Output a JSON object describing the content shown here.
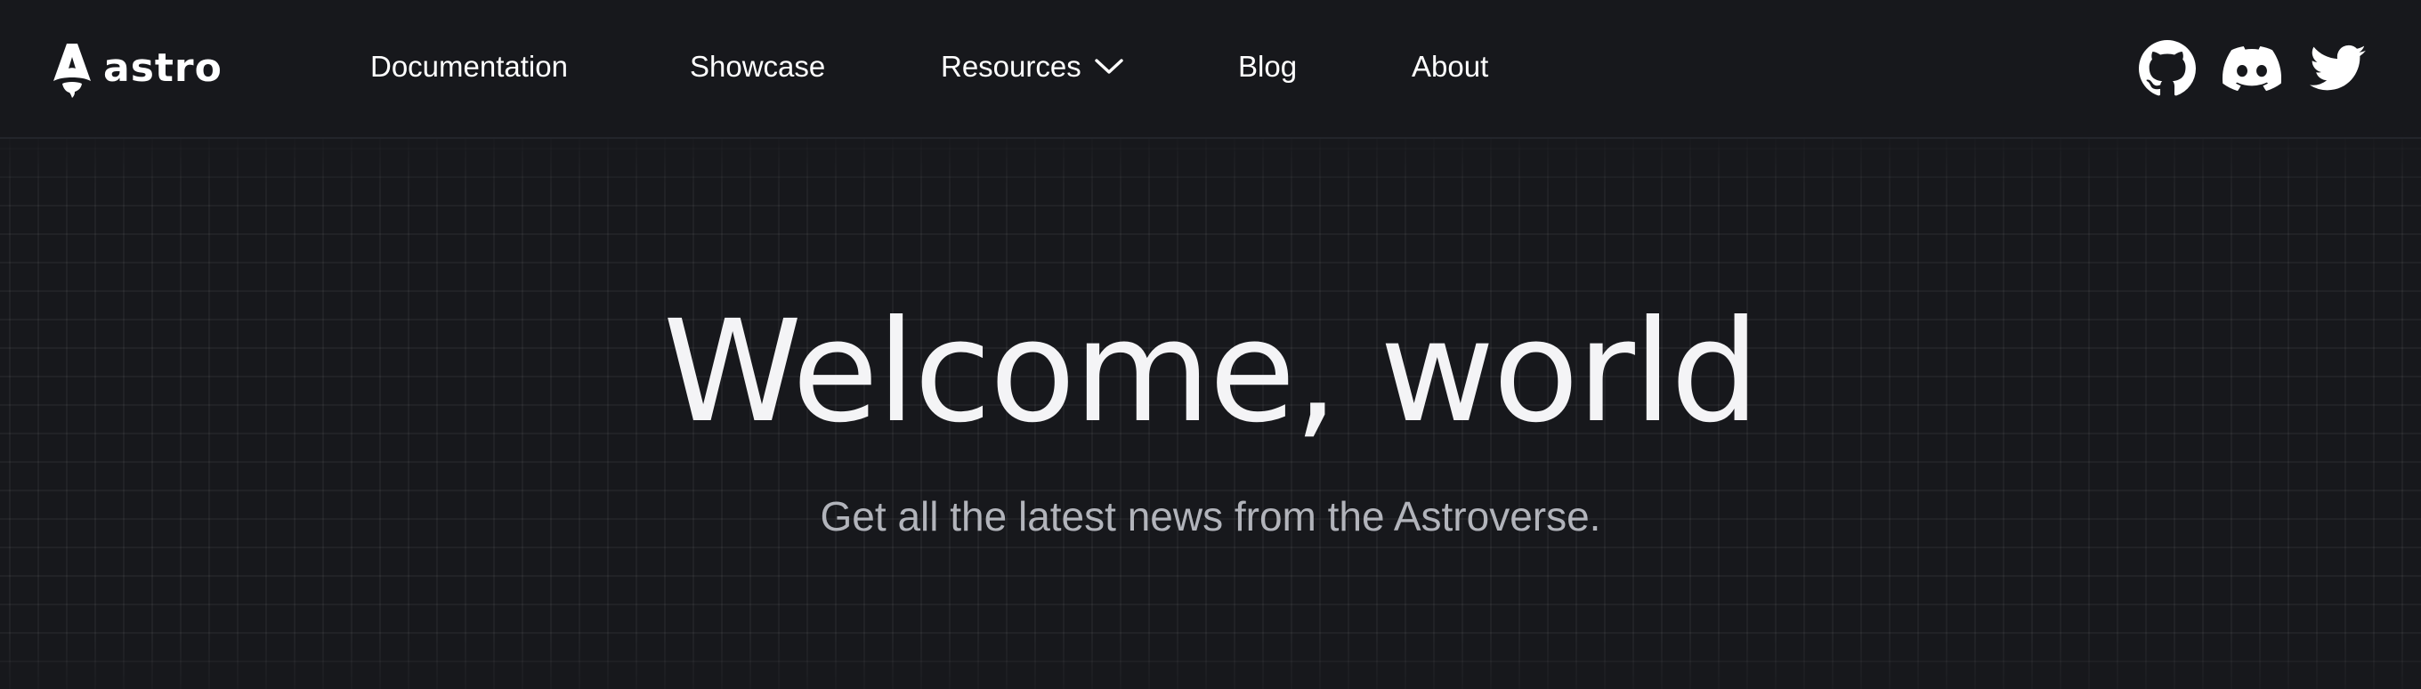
{
  "header": {
    "logo": {
      "wordmark": "astro",
      "icon": "astro-rocket-logo-icon"
    },
    "nav": [
      {
        "label": "Documentation"
      },
      {
        "label": "Showcase"
      },
      {
        "label": "Resources",
        "has_dropdown": true,
        "icon": "chevron-down-icon"
      },
      {
        "label": "Blog"
      },
      {
        "label": "About"
      }
    ],
    "social": [
      {
        "name": "GitHub",
        "icon": "github-icon"
      },
      {
        "name": "Discord",
        "icon": "discord-icon"
      },
      {
        "name": "Twitter",
        "icon": "twitter-icon"
      }
    ]
  },
  "hero": {
    "title": "Welcome, world",
    "subtitle": "Get all the latest news from the Astroverse."
  },
  "colors": {
    "background": "#17181c",
    "header_border": "#23252b",
    "text_primary": "#ffffff",
    "title": "#f4f4f6",
    "text_secondary": "#b2b4bb"
  }
}
